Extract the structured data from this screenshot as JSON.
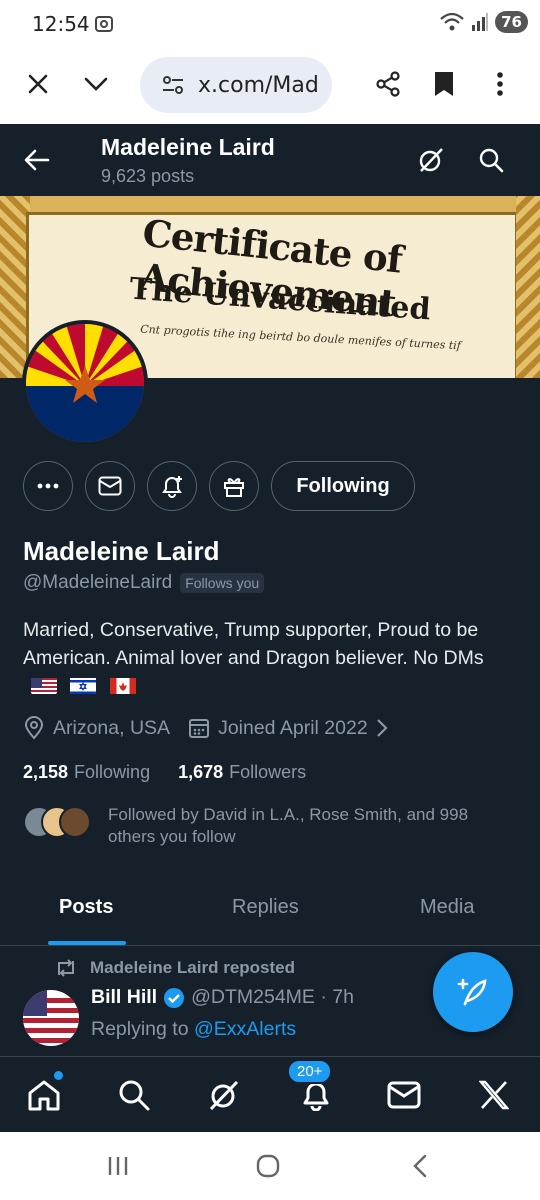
{
  "status_bar": {
    "time": "12:54",
    "battery": "76"
  },
  "browser": {
    "url": "x.com/Mad",
    "icons": [
      "close-icon",
      "chevron-down-icon",
      "site-settings-icon",
      "share-icon",
      "bookmark-icon",
      "more-vert-icon"
    ]
  },
  "header": {
    "name": "Madeleine Laird",
    "post_count": "9,623 posts"
  },
  "banner": {
    "title": "Certificate of Achievement",
    "subtitle": "The Unvaccinated",
    "small_text": "Cnt progotis tihe ing beirtd bo doule menifes of turnes tif"
  },
  "profile": {
    "name": "Madeleine Laird",
    "handle": "@MadeleineLaird",
    "follows_you": "Follows you",
    "bio": "Married, Conservative, Trump supporter, Proud to be American. Animal lover and Dragon believer. No DMs",
    "location": "Arizona, USA",
    "joined": "Joined April 2022",
    "following_count": "2,158",
    "following_label": "Following",
    "followers_count": "1,678",
    "followers_label": "Followers",
    "followed_by": "Followed by David in L.A., Rose Smith, and 998 others you follow"
  },
  "actions": {
    "following_button": "Following"
  },
  "tabs": [
    "Posts",
    "Replies",
    "Media"
  ],
  "post": {
    "repost_label": "Madeleine Laird reposted",
    "author": "Bill Hill",
    "handle_time": "@DTM254ME · 7h",
    "replying_prefix": "Replying to ",
    "replying_to": "@ExxAlerts"
  },
  "bottom_nav": {
    "notifications_badge": "20+"
  },
  "colors": {
    "background": "#15202b",
    "accent": "#1d9bf0"
  }
}
